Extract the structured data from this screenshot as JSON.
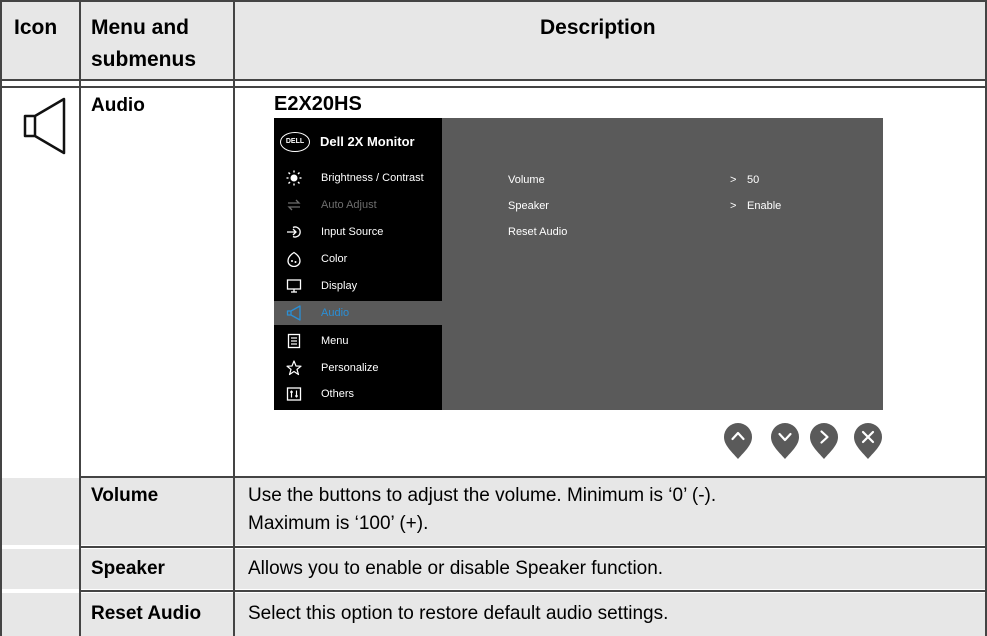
{
  "header": {
    "icon": "Icon",
    "menu_line1": "Menu and",
    "menu_line2": "submenus",
    "description": "Description"
  },
  "audio": {
    "label": "Audio",
    "icon": "speaker-icon",
    "model": "E2X20HS"
  },
  "osd": {
    "logo": "DELL",
    "title": "Dell 2X Monitor",
    "menu": [
      {
        "label": "Brightness / Contrast",
        "icon": "brightness-icon",
        "state": "normal"
      },
      {
        "label": "Auto Adjust",
        "icon": "auto-adjust-icon",
        "state": "disabled"
      },
      {
        "label": "Input Source",
        "icon": "input-source-icon",
        "state": "normal"
      },
      {
        "label": "Color",
        "icon": "color-icon",
        "state": "normal"
      },
      {
        "label": "Display",
        "icon": "display-icon",
        "state": "normal"
      },
      {
        "label": "Audio",
        "icon": "audio-icon",
        "state": "selected"
      },
      {
        "label": "Menu",
        "icon": "menu-icon",
        "state": "normal"
      },
      {
        "label": "Personalize",
        "icon": "star-icon",
        "state": "normal"
      },
      {
        "label": "Others",
        "icon": "others-icon",
        "state": "normal"
      }
    ],
    "options": [
      {
        "label": "Volume",
        "value": "50"
      },
      {
        "label": "Speaker",
        "value": "Enable"
      },
      {
        "label": "Reset Audio",
        "value": ""
      }
    ],
    "value_marker": ">",
    "buttons": [
      {
        "name": "up",
        "icon": "chevron-up-icon"
      },
      {
        "name": "down",
        "icon": "chevron-down-icon"
      },
      {
        "name": "right",
        "icon": "chevron-right-icon"
      },
      {
        "name": "close",
        "icon": "close-icon"
      }
    ]
  },
  "rows": [
    {
      "label": "Volume",
      "desc_line1": "Use the buttons to adjust the volume. Minimum is ‘0’ (-).",
      "desc_line2": "Maximum is ‘100’ (+)."
    },
    {
      "label": "Speaker",
      "desc_line1": "Allows you to enable or disable Speaker function."
    },
    {
      "label": "Reset Audio",
      "desc_line1": "Select this option to restore default audio settings."
    }
  ],
  "colors": {
    "header_bg": "#e7e7e7",
    "grid": "#444444",
    "osd_bg": "#5a5a5a",
    "osd_side": "#000000",
    "osd_accent": "#2a8fd6",
    "button": "#5a5a5a"
  }
}
